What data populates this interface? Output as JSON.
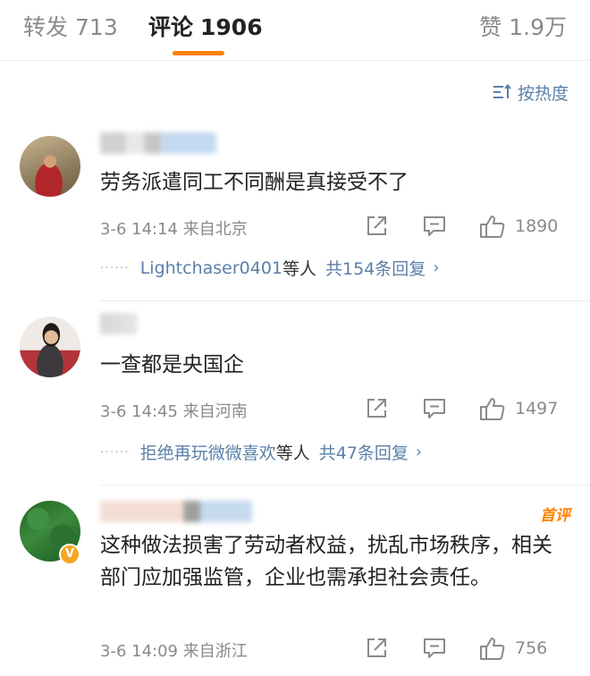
{
  "tabs": {
    "forward_label": "转发",
    "forward_count": "713",
    "comments_label": "评论",
    "comments_count": "1906",
    "likes_label": "赞",
    "likes_count": "1.9万"
  },
  "sort": {
    "label": "按热度",
    "icon": "sort-icon"
  },
  "accent_color": "#ff8200",
  "link_color": "#5a7fa8",
  "comments": [
    {
      "text": "劳务派遣同工不同酬是真接受不了",
      "time": "3-6 14:14",
      "location": "来自北京",
      "likes": "1890",
      "reply_user": "Lightchaser0401",
      "reply_suffix": "等人",
      "reply_total": "共154条回复",
      "reply_chevron": "›"
    },
    {
      "text": "一查都是央国企",
      "time": "3-6 14:45",
      "location": "来自河南",
      "likes": "1497",
      "reply_user": "拒绝再玩微微喜欢",
      "reply_suffix": "等人",
      "reply_total": "共47条回复",
      "reply_chevron": "›"
    },
    {
      "tag": "首评",
      "verified_badge": "V",
      "text": "这种做法损害了劳动者权益，扰乱市场秩序，相关部门应加强监管，企业也需承担社会责任。",
      "time": "3-6 14:09",
      "location": "来自浙江",
      "likes": "756"
    }
  ],
  "reply_dots": "······"
}
